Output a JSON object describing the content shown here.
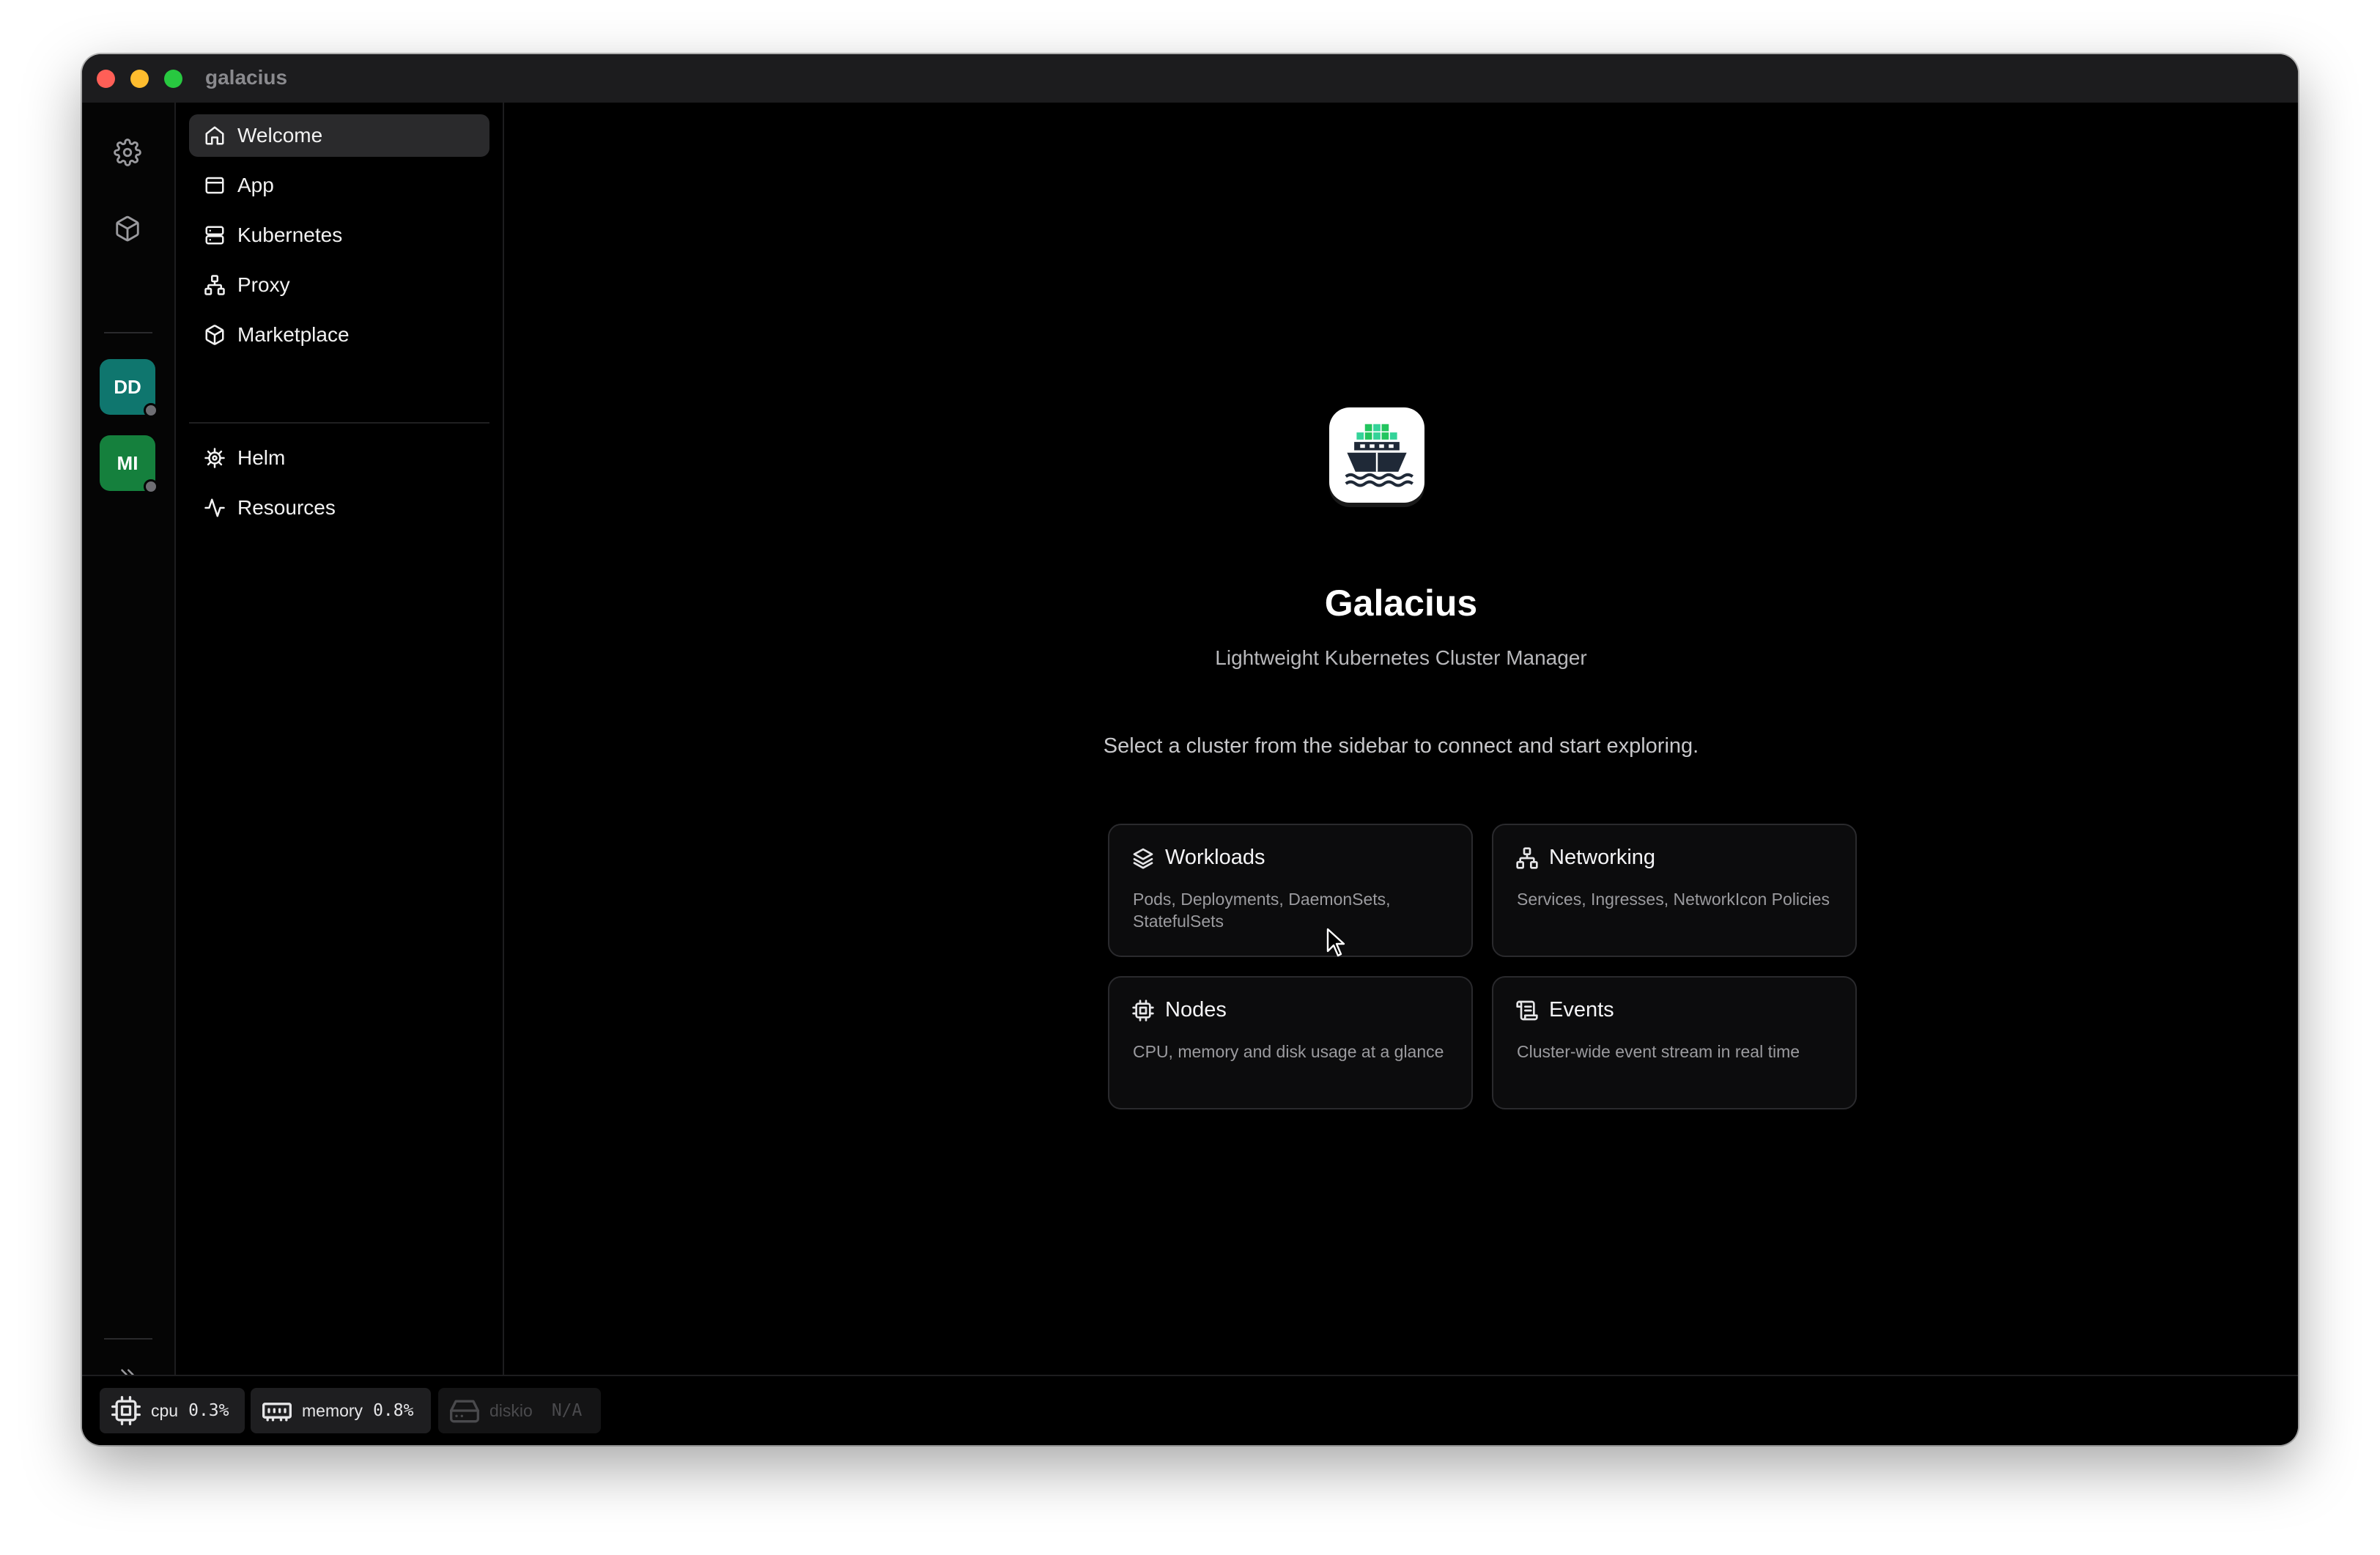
{
  "window": {
    "title": "galacius"
  },
  "rail": {
    "icons": [
      "gear-icon",
      "package-icon"
    ],
    "clusters": [
      {
        "initials": "DD",
        "color": "#0f766e"
      },
      {
        "initials": "MI",
        "color": "#15803d"
      }
    ],
    "expand_icon": "chevrons-right-icon"
  },
  "sidebar": {
    "items": [
      {
        "label": "Welcome",
        "icon": "home-icon"
      },
      {
        "label": "App",
        "icon": "app-window-icon"
      },
      {
        "label": "Kubernetes",
        "icon": "server-icon"
      },
      {
        "label": "Proxy",
        "icon": "network-icon"
      },
      {
        "label": "Marketplace",
        "icon": "package-icon"
      }
    ],
    "items2": [
      {
        "label": "Helm",
        "icon": "helm-icon"
      },
      {
        "label": "Resources",
        "icon": "activity-icon"
      }
    ]
  },
  "welcome": {
    "app_name": "Galacius",
    "subtitle": "Lightweight Kubernetes Cluster Manager",
    "hint": "Select a cluster from the sidebar to connect and start exploring.",
    "cards": [
      {
        "title": "Workloads",
        "desc": "Pods, Deployments, DaemonSets, StatefulSets",
        "icon": "layers-icon"
      },
      {
        "title": "Networking",
        "desc": "Services, Ingresses, NetworkIcon Policies",
        "icon": "network-icon"
      },
      {
        "title": "Nodes",
        "desc": "CPU, memory and disk usage at a glance",
        "icon": "cpu-icon"
      },
      {
        "title": "Events",
        "desc": "Cluster-wide event stream in real time",
        "icon": "scroll-icon"
      }
    ]
  },
  "status": {
    "cpu": {
      "label": "cpu",
      "value": "0.3%"
    },
    "memory": {
      "label": "memory",
      "value": "0.8%"
    },
    "diskio": {
      "label": "diskio",
      "value": "N/A"
    }
  }
}
